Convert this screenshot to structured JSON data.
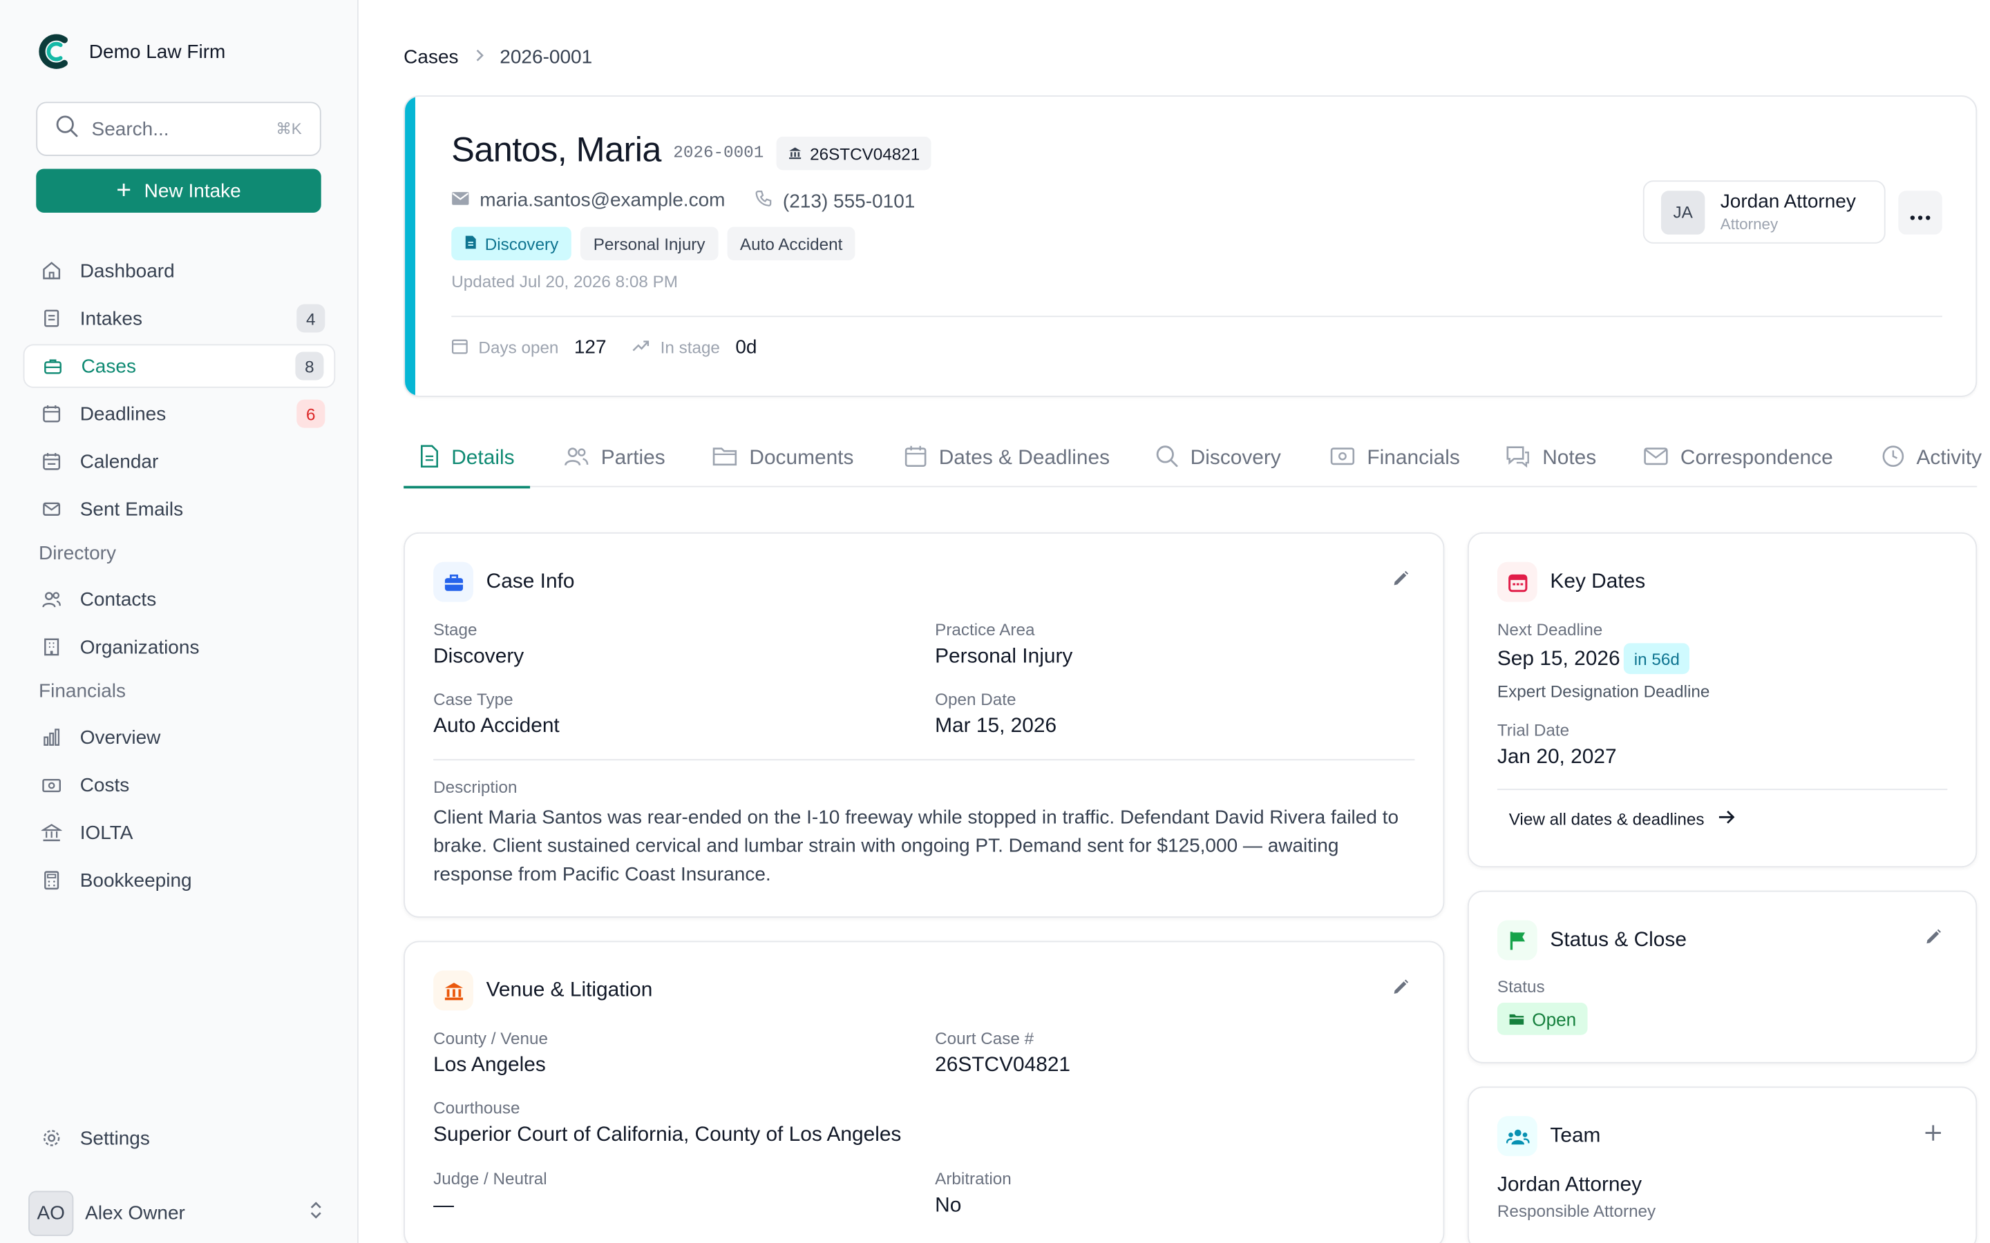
{
  "firm": {
    "name": "Demo Law Firm"
  },
  "search": {
    "placeholder": "Search...",
    "shortcut": "⌘K"
  },
  "new_intake_label": "New Intake",
  "nav": {
    "dashboard": "Dashboard",
    "intakes": "Intakes",
    "intakes_count": "4",
    "cases": "Cases",
    "cases_count": "8",
    "deadlines": "Deadlines",
    "deadlines_count": "6",
    "calendar": "Calendar",
    "sent_emails": "Sent Emails",
    "directory_label": "Directory",
    "contacts": "Contacts",
    "organizations": "Organizations",
    "financials_label": "Financials",
    "overview": "Overview",
    "costs": "Costs",
    "iolta": "IOLTA",
    "bookkeeping": "Bookkeeping",
    "settings": "Settings"
  },
  "user": {
    "initials": "AO",
    "name": "Alex Owner"
  },
  "breadcrumb": {
    "root": "Cases",
    "current": "2026-0001"
  },
  "case": {
    "client_name": "Santos, Maria",
    "number": "2026-0001",
    "court_case": "26STCV04821",
    "email": "maria.santos@example.com",
    "phone": "(213) 555-0101",
    "tags": {
      "stage": "Discovery",
      "practice": "Personal Injury",
      "type": "Auto Accident"
    },
    "updated": "Updated Jul 20, 2026 8:08 PM",
    "days_open_label": "Days open",
    "days_open": "127",
    "in_stage_label": "In stage",
    "in_stage": "0d",
    "attorney": {
      "initials": "JA",
      "name": "Jordan Attorney",
      "role": "Attorney"
    }
  },
  "tabs": [
    "Details",
    "Parties",
    "Documents",
    "Dates & Deadlines",
    "Discovery",
    "Financials",
    "Notes",
    "Correspondence",
    "Activity"
  ],
  "case_info": {
    "title": "Case Info",
    "stage_label": "Stage",
    "stage": "Discovery",
    "practice_label": "Practice Area",
    "practice": "Personal Injury",
    "type_label": "Case Type",
    "type": "Auto Accident",
    "open_label": "Open Date",
    "open_date": "Mar 15, 2026",
    "description_label": "Description",
    "description": "Client Maria Santos was rear-ended on the I-10 freeway while stopped in traffic. Defendant David Rivera failed to brake. Client sustained cervical and lumbar strain with ongoing PT. Demand sent for $125,000 — awaiting response from Pacific Coast Insurance."
  },
  "venue": {
    "title": "Venue & Litigation",
    "county_label": "County / Venue",
    "county": "Los Angeles",
    "court_case_label": "Court Case #",
    "court_case": "26STCV04821",
    "courthouse_label": "Courthouse",
    "courthouse": "Superior Court of California, County of Los Angeles",
    "judge_label": "Judge / Neutral",
    "judge": "—",
    "arbitration_label": "Arbitration",
    "arbitration": "No"
  },
  "key_dates": {
    "title": "Key Dates",
    "next_label": "Next Deadline",
    "next_date": "Sep 15, 2026",
    "next_in": "in 56d",
    "next_desc": "Expert Designation Deadline",
    "trial_label": "Trial Date",
    "trial_date": "Jan 20, 2027",
    "view_all": "View all dates & deadlines"
  },
  "status_close": {
    "title": "Status & Close",
    "status_label": "Status",
    "status": "Open"
  },
  "team": {
    "title": "Team",
    "member_name": "Jordan Attorney",
    "member_role": "Responsible Attorney"
  },
  "colors": {
    "brand": "#0f8a73",
    "accent": "#06b6d4",
    "danger": "#dc2626",
    "success": "#15803d"
  }
}
